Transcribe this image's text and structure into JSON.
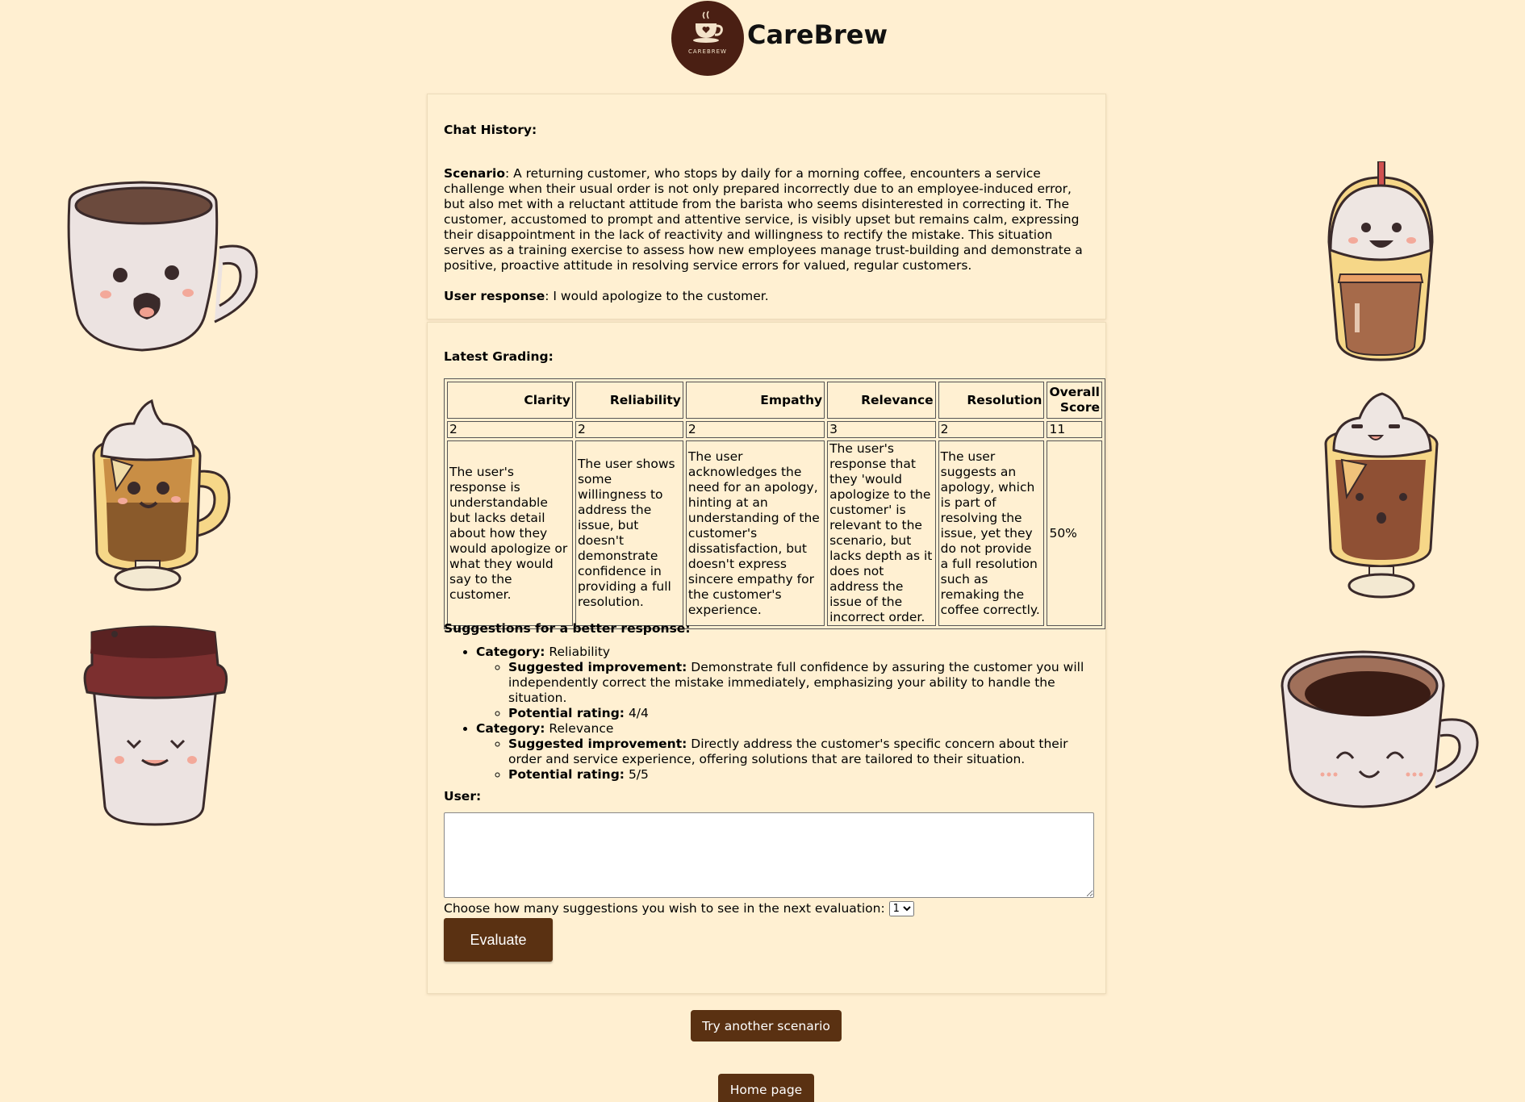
{
  "header": {
    "logo_text": "CAREBREW",
    "brand": "CareBrew"
  },
  "chat": {
    "title": "Chat History:",
    "scenario_label": "Scenario",
    "scenario_text": ": A returning customer, who stops by daily for a morning coffee, encounters a service challenge when their usual order is not only prepared incorrectly due to an employee-induced error, but also met with a reluctant attitude from the barista who seems disinterested in correcting it. The customer, accustomed to prompt and attentive service, is visibly upset but remains calm, expressing their disappointment in the lack of reactivity and willingness to rectify the mistake. This situation serves as a training exercise to assess how new employees manage trust-building and demonstrate a positive, proactive attitude in resolving service errors for valued, regular customers.",
    "user_response_label": "User response",
    "user_response_text": ": I would apologize to the customer."
  },
  "grading": {
    "title": "Latest Grading:",
    "headers": [
      "Clarity",
      "Reliability",
      "Empathy",
      "Relevance",
      "Resolution",
      "Overall Score"
    ],
    "scores": [
      "2",
      "2",
      "2",
      "3",
      "2",
      "11"
    ],
    "comments": [
      "The user's response is understandable but lacks detail about how they would apologize or what they would say to the customer.",
      "The user shows some willingness to address the issue, but doesn't demonstrate confidence in providing a full resolution.",
      "The user acknowledges the need for an apology, hinting at an understanding of the customer's dissatisfaction, but doesn't express sincere empathy for the customer's experience.",
      "The user's response that they 'would apologize to the customer' is relevant to the scenario, but lacks depth as it does not address the issue of the incorrect order.",
      "The user suggests an apology, which is part of resolving the issue, yet they do not provide a full resolution such as remaking the coffee correctly.",
      "50%"
    ]
  },
  "suggestions": {
    "title": "Suggestions for a better response:",
    "category_label": "Category:",
    "improvement_label": "Suggested improvement:",
    "rating_label": "Potential rating:",
    "items": [
      {
        "category": " Reliability",
        "improvement": " Demonstrate full confidence by assuring the customer you will independently correct the mistake immediately, emphasizing your ability to handle the situation.",
        "rating": " 4/4"
      },
      {
        "category": " Relevance",
        "improvement": " Directly address the customer's specific concern about their order and service experience, offering solutions that are tailored to their situation.",
        "rating": " 5/5"
      }
    ]
  },
  "form": {
    "user_label": "User:",
    "user_value": "",
    "choose_label": "Choose how many suggestions you wish to see in the next evaluation:",
    "choose_value": "1",
    "evaluate_label": "Evaluate"
  },
  "nav": {
    "try_another": "Try another scenario",
    "home": "Home page"
  }
}
